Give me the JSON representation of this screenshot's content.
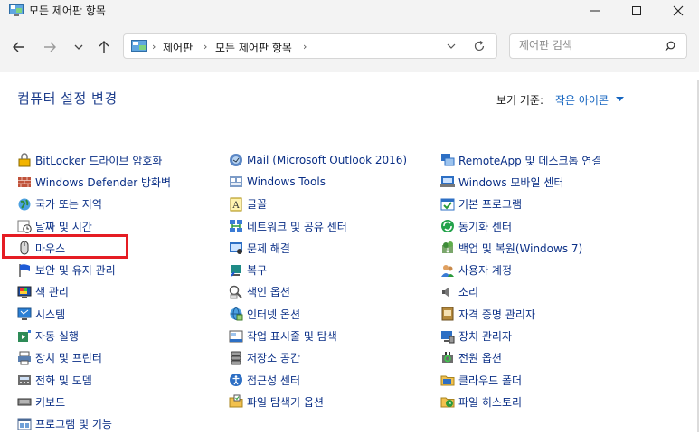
{
  "window": {
    "title": "모든 제어판 항목"
  },
  "nav": {
    "breadcrumbs": [
      "제어판",
      "모든 제어판 항목"
    ],
    "search_placeholder": "제어판 검색"
  },
  "header": {
    "title": "컴퓨터 설정 변경",
    "view_label": "보기 기준:",
    "view_value": "작은 아이콘"
  },
  "columns": [
    [
      {
        "label": "BitLocker 드라이브 암호화",
        "icon": "bitlocker-icon"
      },
      {
        "label": "Windows Defender 방화벽",
        "icon": "firewall-icon"
      },
      {
        "label": "국가 또는 지역",
        "icon": "region-icon"
      },
      {
        "label": "날짜 및 시간",
        "icon": "clock-icon"
      },
      {
        "label": "마우스",
        "icon": "mouse-icon"
      },
      {
        "label": "보안 및 유지 관리",
        "icon": "flag-icon"
      },
      {
        "label": "색 관리",
        "icon": "color-management-icon"
      },
      {
        "label": "시스템",
        "icon": "system-icon"
      },
      {
        "label": "자동 실행",
        "icon": "autoplay-icon"
      },
      {
        "label": "장치 및 프린터",
        "icon": "printer-icon"
      },
      {
        "label": "전화 및 모뎀",
        "icon": "phone-modem-icon"
      },
      {
        "label": "키보드",
        "icon": "keyboard-icon"
      },
      {
        "label": "프로그램 및 기능",
        "icon": "programs-icon"
      }
    ],
    [
      {
        "label": "Mail (Microsoft Outlook 2016)",
        "icon": "mail-icon"
      },
      {
        "label": "Windows Tools",
        "icon": "windows-tools-icon"
      },
      {
        "label": "글꼴",
        "icon": "font-icon"
      },
      {
        "label": "네트워크 및 공유 센터",
        "icon": "network-icon"
      },
      {
        "label": "문제 해결",
        "icon": "troubleshoot-icon"
      },
      {
        "label": "복구",
        "icon": "recovery-icon"
      },
      {
        "label": "색인 옵션",
        "icon": "indexing-icon"
      },
      {
        "label": "인터넷 옵션",
        "icon": "internet-options-icon"
      },
      {
        "label": "작업 표시줄 및 탐색",
        "icon": "taskbar-icon"
      },
      {
        "label": "저장소 공간",
        "icon": "storage-icon"
      },
      {
        "label": "접근성 센터",
        "icon": "accessibility-icon"
      },
      {
        "label": "파일 탐색기 옵션",
        "icon": "folder-options-icon"
      }
    ],
    [
      {
        "label": "RemoteApp 및 데스크톱 연결",
        "icon": "remoteapp-icon"
      },
      {
        "label": "Windows 모바일 센터",
        "icon": "mobility-center-icon"
      },
      {
        "label": "기본 프로그램",
        "icon": "default-programs-icon"
      },
      {
        "label": "동기화 센터",
        "icon": "sync-icon"
      },
      {
        "label": "백업 및 복원(Windows 7)",
        "icon": "backup-icon"
      },
      {
        "label": "사용자 계정",
        "icon": "user-accounts-icon"
      },
      {
        "label": "소리",
        "icon": "speaker-icon"
      },
      {
        "label": "자격 증명 관리자",
        "icon": "credential-icon"
      },
      {
        "label": "장치 관리자",
        "icon": "device-manager-icon"
      },
      {
        "label": "전원 옵션",
        "icon": "power-icon"
      },
      {
        "label": "클라우드 폴더",
        "icon": "cloud-folder-icon"
      },
      {
        "label": "파일 히스토리",
        "icon": "file-history-icon"
      }
    ]
  ],
  "colors": {
    "link": "#0a2f86",
    "heading": "#1e3e8c",
    "accent": "#1565c0",
    "highlight": "#e51c23"
  }
}
